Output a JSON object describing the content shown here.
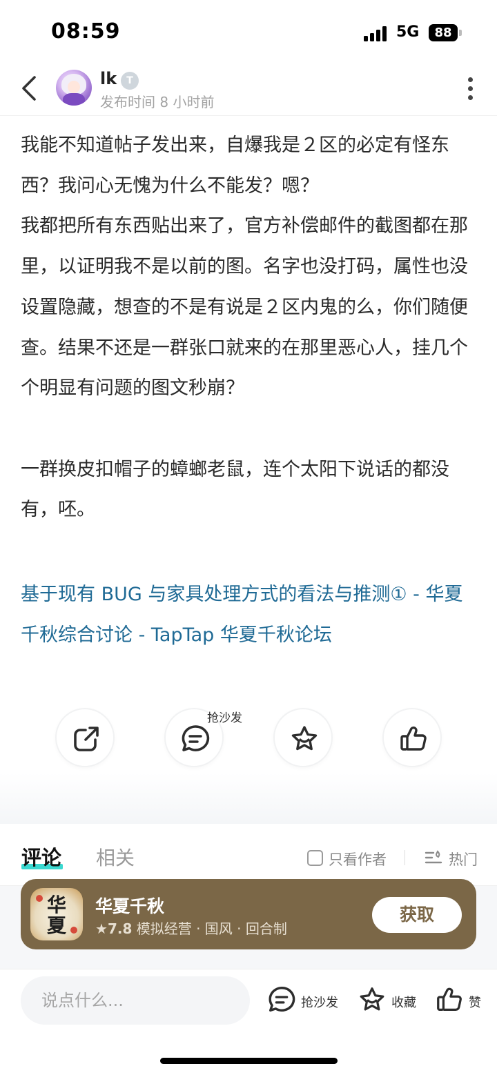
{
  "status_bar": {
    "time": "08:59",
    "network": "5G",
    "battery": "88"
  },
  "header": {
    "username": "lk",
    "badge": "T",
    "post_time": "发布时间 8 小时前"
  },
  "post": {
    "body": "我能不知道帖子发出来，自爆我是２区的必定有怪东西？我问心无愧为什么不能发？嗯？\n我都把所有东西贴出来了，官方补偿邮件的截图都在那里，以证明我不是以前的图。名字也没打码，属性也没设置隐藏，想查的不是有说是２区内鬼的么，你们随便查。结果不还是一群张口就来的在那里恶心人，挂几个个明显有问题的图文秒崩？\n\n一群换皮扣帽子的蟑螂老鼠，连个太阳下说话的都没有，呸。",
    "link": "基于现有 BUG 与家具处理方式的看法与推测① - 华夏千秋综合讨论 - TapTap 华夏千秋论坛"
  },
  "actions": {
    "comment_hint": "抢沙发",
    "icons": [
      "share-icon",
      "comment-icon",
      "favorite-icon",
      "like-icon"
    ]
  },
  "tabs": {
    "comments": "评论",
    "related": "相关",
    "author_only": "只看作者",
    "sort": "热门"
  },
  "game": {
    "icon_text_top": "华",
    "icon_text_bottom": "夏",
    "name": "华夏千秋",
    "rating": "7.8",
    "tags": "模拟经营 · 国风 · 回合制",
    "get_label": "获取"
  },
  "bottom_bar": {
    "input_placeholder": "说点什么...",
    "comment_label": "抢沙发",
    "favorite_label": "收藏",
    "like_label": "赞"
  },
  "colors": {
    "link": "#1f6a95",
    "tab_accent": "#3ad8d0",
    "banner_bg": "#7b6747"
  }
}
